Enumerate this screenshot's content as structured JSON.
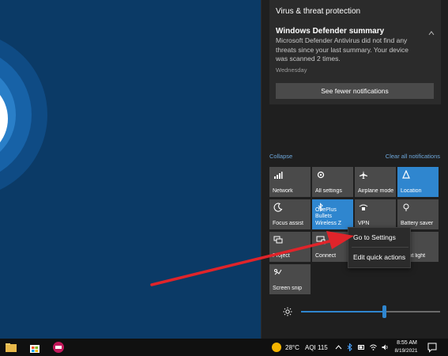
{
  "notification": {
    "app": "Virus & threat protection",
    "title": "Windows Defender summary",
    "body": "Microsoft Defender Antivirus did not find any threats since your last summary.  Your device was scanned 2 times.",
    "time": "Wednesday",
    "see_fewer": "See fewer notifications"
  },
  "action_center": {
    "collapse": "Collapse",
    "clear_all": "Clear all notifications",
    "tiles": [
      {
        "label": "Network",
        "icon": "network-icon",
        "active": false
      },
      {
        "label": "All settings",
        "icon": "gear-icon",
        "active": false
      },
      {
        "label": "Airplane mode",
        "icon": "airplane-icon",
        "active": false
      },
      {
        "label": "Location",
        "icon": "location-icon",
        "active": true
      },
      {
        "label": "Focus assist",
        "icon": "moon-icon",
        "active": false
      },
      {
        "label": "OnePlus Bullets Wireless Z",
        "icon": "bluetooth-icon",
        "active": true
      },
      {
        "label": "VPN",
        "icon": "vpn-icon",
        "active": false
      },
      {
        "label": "Battery saver",
        "icon": "battery-saver-icon",
        "active": false
      },
      {
        "label": "Project",
        "icon": "project-icon",
        "active": false
      },
      {
        "label": "Connect",
        "icon": "connect-icon",
        "active": false
      },
      {
        "label": "",
        "icon": "",
        "active": false
      },
      {
        "label": "Night light",
        "icon": "night-light-icon",
        "active": false
      },
      {
        "label": "Screen snip",
        "icon": "screen-snip-icon",
        "active": false
      }
    ],
    "brightness": 0.6
  },
  "context_menu": {
    "items": [
      "Go to Settings",
      "Edit quick actions"
    ]
  },
  "taskbar": {
    "temperature": "28°C",
    "aqi": "AQI 115",
    "time": "8:55 AM",
    "date": "8/19/2021"
  },
  "colors": {
    "accent": "#2f86cf",
    "arrow": "#e0242a"
  }
}
